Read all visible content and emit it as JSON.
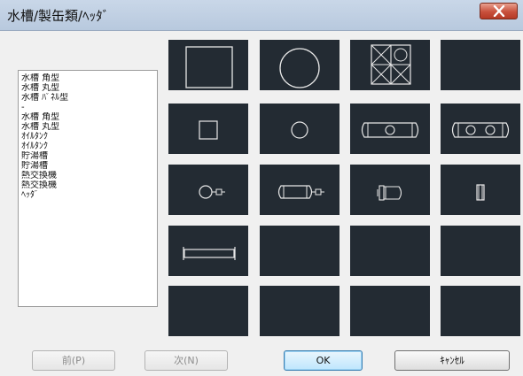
{
  "window": {
    "title": "水槽/製缶類/ﾍｯﾀﾞ",
    "close_icon": "close-x-icon"
  },
  "list": {
    "items": [
      "水槽 角型",
      "水槽 丸型",
      "水槽 ﾊﾟﾈﾙ型",
      "-",
      "水槽 角型",
      "水槽 丸型",
      "ｵｲﾙﾀﾝｸ",
      "ｵｲﾙﾀﾝｸ",
      "貯湯槽",
      "貯湯槽",
      "熱交換機",
      "熱交換機",
      "ﾍｯﾀﾞ"
    ]
  },
  "grid": {
    "tiles": [
      "square-large-icon",
      "circle-large-icon",
      "panel-tank-grid-icon",
      "empty",
      "square-small-icon",
      "circle-small-icon",
      "horizontal-tank-one-hole-icon",
      "horizontal-tank-two-holes-icon",
      "round-tank-with-nozzle-icon",
      "horizontal-tank-with-nozzle-icon",
      "small-tank-side-icon",
      "narrow-rectangle-icon",
      "header-pipe-icon",
      "empty",
      "empty",
      "empty",
      "empty",
      "empty",
      "empty",
      "empty"
    ]
  },
  "buttons": {
    "prev": "前(P)",
    "next": "次(N)",
    "ok": "OK",
    "cancel": "ｷｬﾝｾﾙ"
  },
  "colors": {
    "tile_background": "#232b33",
    "tile_line": "#e8e8e8",
    "close_button": "#c8503c"
  }
}
